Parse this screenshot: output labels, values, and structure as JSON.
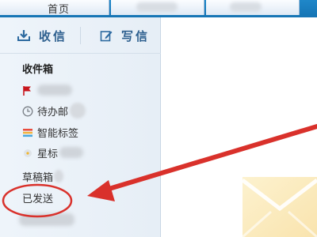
{
  "tabs": {
    "home_label": "首页"
  },
  "sidebar": {
    "receive_label": "收信",
    "write_label": "写信",
    "folders": {
      "inbox": "收件箱",
      "todo": "待办邮",
      "tags": "智能标签",
      "starred": "星标",
      "drafts": "草稿箱",
      "sent": "已发送"
    }
  },
  "colors": {
    "tab_bar": "#1574b4",
    "sidebar_bg": "#eef4fa",
    "accent_text": "#2d5f8e",
    "annotation_red": "#d9312b",
    "flag_red": "#c8161d"
  },
  "icons": {
    "receive": "download-tray-icon",
    "write": "edit-pen-icon",
    "flag": "red-flag-icon",
    "todo": "clock-icon",
    "tags": "color-tag-icon",
    "starred": "star-icon",
    "envelope": "envelope-icon"
  }
}
